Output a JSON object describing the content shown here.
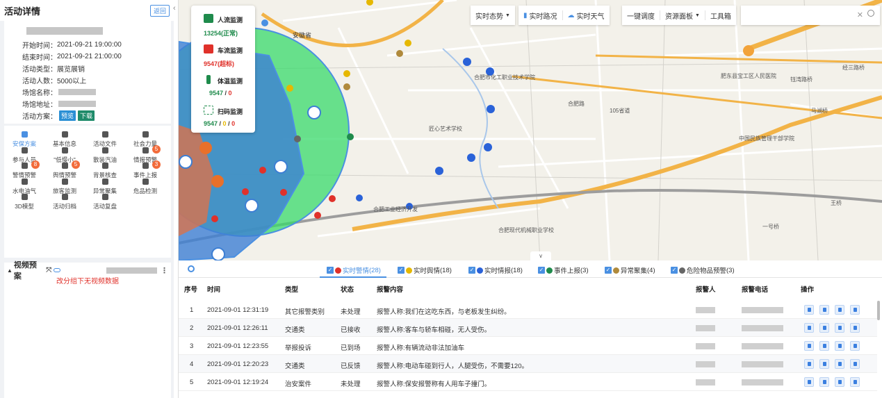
{
  "panel": {
    "title": "活动详情",
    "back": "返回"
  },
  "info": {
    "rows": [
      {
        "label": "开始时间：",
        "value": "2021-09-21 19:00:00"
      },
      {
        "label": "结束时间：",
        "value": "2021-09-21 21:00:00"
      },
      {
        "label": "活动类型：",
        "value": "展览展销"
      },
      {
        "label": "活动人数：",
        "value": "5000以上"
      },
      {
        "label": "场馆名称：",
        "value": ""
      },
      {
        "label": "场馆地址：",
        "value": ""
      },
      {
        "label": "活动方案：",
        "value": ""
      }
    ],
    "preview": "预览",
    "download": "下载"
  },
  "functions": [
    {
      "label": "安保方案",
      "icon": "security-plan-icon",
      "badge": ""
    },
    {
      "label": "基本信息",
      "icon": "info-icon",
      "badge": ""
    },
    {
      "label": "活动文件",
      "icon": "file-icon",
      "badge": ""
    },
    {
      "label": "社会力量",
      "icon": "social-force-icon",
      "badge": ""
    },
    {
      "label": "参与人员",
      "icon": "people-icon",
      "badge": ""
    },
    {
      "label": "\"低慢小\"",
      "icon": "drone-icon",
      "badge": ""
    },
    {
      "label": "散装汽油",
      "icon": "fuel-icon",
      "badge": ""
    },
    {
      "label": "情报预警",
      "icon": "intel-icon",
      "badge": "5"
    },
    {
      "label": "警情预警",
      "icon": "alarm-icon",
      "badge": "8"
    },
    {
      "label": "舆情预警",
      "icon": "public-opinion-icon",
      "badge": "5"
    },
    {
      "label": "背景核查",
      "icon": "check-icon",
      "badge": ""
    },
    {
      "label": "事件上报",
      "icon": "report-icon",
      "badge": "3"
    },
    {
      "label": "水电油气",
      "icon": "utility-icon",
      "badge": ""
    },
    {
      "label": "旅客监测",
      "icon": "passenger-icon",
      "badge": ""
    },
    {
      "label": "异常聚集",
      "icon": "crowd-icon",
      "badge": ""
    },
    {
      "label": "危品检测",
      "icon": "warning-icon",
      "badge": ""
    },
    {
      "label": "3D模型",
      "icon": "model-icon",
      "badge": ""
    },
    {
      "label": "活动归档",
      "icon": "archive-icon",
      "badge": ""
    },
    {
      "label": "活动复盘",
      "icon": "review-icon",
      "badge": ""
    }
  ],
  "video": {
    "title": "视频预案",
    "empty": "改分组下无视频数据"
  },
  "stats": [
    {
      "label": "人流监测",
      "value": "13254(正常)",
      "color": "#1f8b4c"
    },
    {
      "label": "车流监测",
      "value": "9547(超标)",
      "color": "#e0312a"
    },
    {
      "label": "体温监测",
      "value_a": "9547",
      "sep": " / ",
      "value_b": "0"
    },
    {
      "label": "扫码监测",
      "value_a": "9547",
      "sep1": " / ",
      "value_b": "0",
      "sep2": " / ",
      "value_c": "0"
    }
  ],
  "toolbar": {
    "situation": "实时态势",
    "traffic": "实时路况",
    "weather": "实时天气",
    "dispatch": "一键调度",
    "resource": "资源面板",
    "tools": "工具箱"
  },
  "map_labels": {
    "province": "安徽省",
    "school1": "合肥市化工职业技术学院",
    "school2": "匠心艺术学校",
    "school3": "中国民族管理干部学院",
    "park": "合肥工业经济开发",
    "school4": "合肥现代机械职业学校",
    "road1": "105省道",
    "road2": "合肥路",
    "town": "马湖桥",
    "town2": "经三路桥",
    "town3": "钰湾路桥",
    "town4": "王桥",
    "town5": "一号桥",
    "town6": "肥东县宝工区人民医院"
  },
  "tabs": [
    {
      "label": "实时警情",
      "count": "(28)",
      "color": "#e0312a"
    },
    {
      "label": "实时舆情",
      "count": "(18)",
      "color": "#e6b800"
    },
    {
      "label": "实时情报",
      "count": "(18)",
      "color": "#2a62d8"
    },
    {
      "label": "事件上报",
      "count": "(3)",
      "color": "#1f8b4c"
    },
    {
      "label": "异常聚集",
      "count": "(4)",
      "color": "#b08a3c"
    },
    {
      "label": "危险物品预警",
      "count": "(3)",
      "color": "#666666"
    }
  ],
  "table": {
    "headers": [
      "序号",
      "时间",
      "类型",
      "状态",
      "报警内容",
      "报警人",
      "报警电话",
      "操作"
    ],
    "rows": [
      {
        "no": "1",
        "time": "2021-09-01 12:31:19",
        "type": "其它报警类别",
        "status": "未处理",
        "content": "报警人称:我们在这吃东西，与老板发生纠纷。"
      },
      {
        "no": "2",
        "time": "2021-09-01 12:26:11",
        "type": "交通类",
        "status": "已接收",
        "content": "报警人称:客车与轿车相碰，无人受伤。"
      },
      {
        "no": "3",
        "time": "2021-09-01 12:23:55",
        "type": "举报投诉",
        "status": "已到场",
        "content": "报警人称:有辆流动非法加油车"
      },
      {
        "no": "4",
        "time": "2021-09-01 12:20:23",
        "type": "交通类",
        "status": "已反馈",
        "content": "报警人称:电动车碰到行人，人腿受伤，不需要120。"
      },
      {
        "no": "5",
        "time": "2021-09-01 12:19:24",
        "type": "治安案件",
        "status": "未处理",
        "content": "报警人称:保安报警称有人用车子撞门。"
      }
    ]
  }
}
